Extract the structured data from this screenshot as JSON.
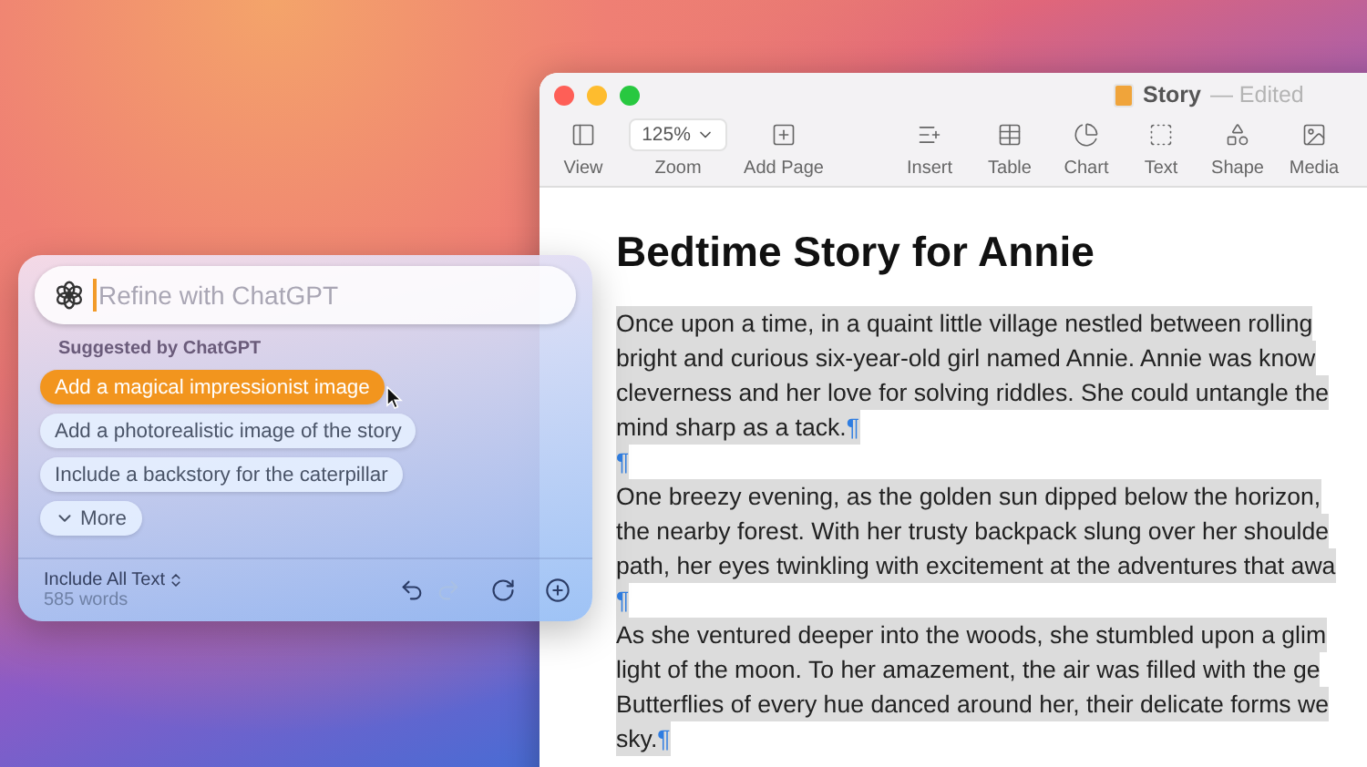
{
  "window": {
    "title": "Story",
    "status": "— Edited"
  },
  "toolbar": [
    {
      "kind": "view",
      "label": "View"
    },
    {
      "kind": "zoom",
      "label": "Zoom",
      "value": "125%"
    },
    {
      "kind": "add_page",
      "label": "Add Page"
    },
    {
      "kind": "insert",
      "label": "Insert"
    },
    {
      "kind": "table",
      "label": "Table"
    },
    {
      "kind": "chart",
      "label": "Chart"
    },
    {
      "kind": "text",
      "label": "Text"
    },
    {
      "kind": "shape",
      "label": "Shape"
    },
    {
      "kind": "media",
      "label": "Media"
    }
  ],
  "document": {
    "heading": "Bedtime Story for Annie",
    "pilcrow": "¶",
    "paragraphs": [
      {
        "selected": true,
        "end_mark": true,
        "lines": [
          "Once upon a time, in a quaint little village nestled between rolling",
          "bright and curious six-year-old girl named Annie. Annie was know",
          "cleverness and her love for solving riddles. She could untangle the",
          "mind sharp as a tack."
        ]
      },
      {
        "selected": true,
        "end_mark": true
      },
      {
        "selected": true,
        "end_mark": false,
        "lines": [
          "One breezy evening, as the golden sun dipped below the horizon,",
          "the nearby forest. With her trusty backpack slung over her shoulde",
          "path, her eyes twinkling with excitement at the adventures that awa"
        ]
      },
      {
        "selected": true,
        "end_mark": true
      },
      {
        "selected": true,
        "end_mark": true,
        "lines": [
          "As she ventured deeper into the woods, she stumbled upon a glim",
          "light of the moon. To her amazement, the air was filled with the ge",
          "Butterflies of every hue danced around her, their delicate forms we",
          "sky."
        ]
      }
    ]
  },
  "assistant": {
    "placeholder": "Refine with ChatGPT",
    "section_label": "Suggested by ChatGPT",
    "suggestions": [
      {
        "label": "Add a magical impressionist image",
        "selected": true
      },
      {
        "label": "Add a photorealistic image of the story",
        "selected": false
      },
      {
        "label": "Include a backstory for the caterpillar",
        "selected": false
      }
    ],
    "more": "More",
    "scope": "Include All Text",
    "word_count": "585 words",
    "actions": [
      {
        "kind": "undo",
        "disabled": false
      },
      {
        "kind": "redo",
        "disabled": true
      },
      {
        "kind": "refresh",
        "disabled": false
      },
      {
        "kind": "add",
        "disabled": false
      }
    ]
  }
}
